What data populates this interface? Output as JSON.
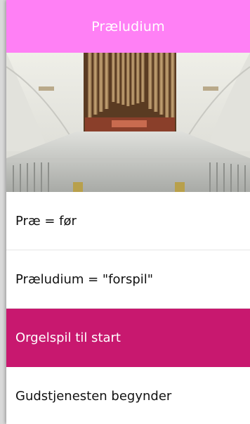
{
  "header": {
    "title": "Præludium"
  },
  "hero": {
    "image": "church-organ-photo"
  },
  "list": {
    "items": [
      {
        "label": "Præ = før"
      },
      {
        "label": "Præludium = \"forspil\""
      },
      {
        "label": "Orgelspil til start"
      },
      {
        "label": "Gudstjenesten begynder"
      }
    ]
  },
  "colors": {
    "header_bg": "#ff80f5",
    "active_bg": "#c8186f"
  }
}
